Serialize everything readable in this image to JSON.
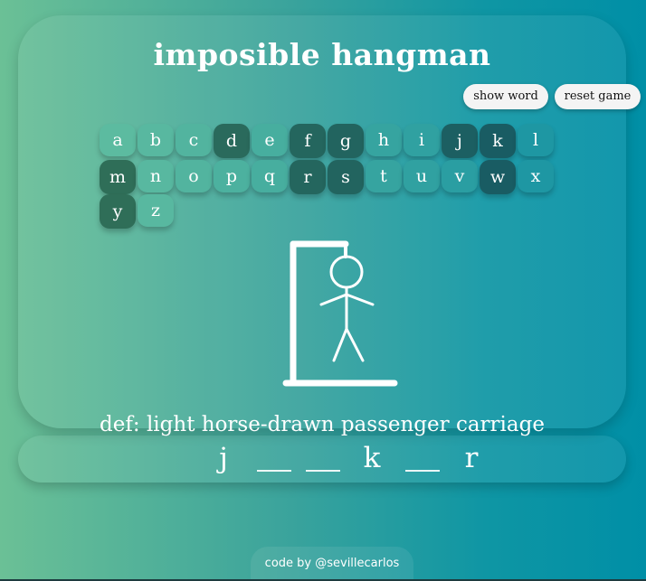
{
  "title": "imposible hangman",
  "buttons": {
    "show_word": "show word",
    "reset_game": "reset game"
  },
  "keyboard": {
    "letters": [
      "a",
      "b",
      "c",
      "d",
      "e",
      "f",
      "g",
      "h",
      "i",
      "j",
      "k",
      "l",
      "m",
      "n",
      "o",
      "p",
      "q",
      "r",
      "s",
      "t",
      "u",
      "v",
      "w",
      "x",
      "y",
      "z"
    ],
    "used_letters": [
      "d",
      "f",
      "g",
      "j",
      "k",
      "m",
      "r",
      "s",
      "w",
      "y"
    ]
  },
  "hangman": {
    "stage": "full-figure",
    "color": "#ffffff"
  },
  "definition": "def: light horse-drawn passenger carriage",
  "word_slots": [
    "j",
    "",
    "",
    "k",
    "",
    "r"
  ],
  "credit": "code by @sevillecarlos",
  "colors": {
    "gradient_start": "#6bc096",
    "gradient_end": "#008fa6",
    "key_used": "#256b5e",
    "button_bg": "#f4f4f4"
  }
}
